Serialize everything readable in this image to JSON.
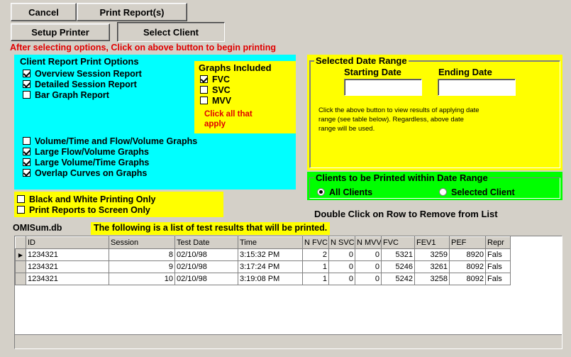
{
  "toolbar": {
    "cancel": "Cancel",
    "print_reports": "Print Report(s)",
    "setup_printer": "Setup Printer",
    "select_client": "Select Client"
  },
  "instruction": "After selecting options, Click on above button to begin printing",
  "client_report_options": {
    "title": "Client Report Print Options",
    "items": [
      {
        "label": "Overview Session Report",
        "checked": true
      },
      {
        "label": "Detailed Session Report",
        "checked": true
      },
      {
        "label": "Bar Graph Report",
        "checked": false
      }
    ],
    "graph_items": [
      {
        "label": "Volume/Time and Flow/Volume Graphs",
        "checked": false
      },
      {
        "label": "Large Flow/Volume Graphs",
        "checked": true
      },
      {
        "label": "Large Volume/Time Graphs",
        "checked": true
      },
      {
        "label": "Overlap Curves on Graphs",
        "checked": true
      }
    ]
  },
  "graphs_included": {
    "title": "Graphs Included",
    "items": [
      {
        "label": "FVC",
        "checked": true
      },
      {
        "label": "SVC",
        "checked": false
      },
      {
        "label": "MVV",
        "checked": false
      }
    ],
    "note_line1": "Click all that",
    "note_line2": "apply"
  },
  "print_flags": [
    {
      "label": "Black and White Printing Only",
      "checked": false
    },
    {
      "label": "Print Reports to Screen Only",
      "checked": false
    }
  ],
  "date_range": {
    "title": "Selected Date Range",
    "start_label": "Starting Date",
    "end_label": "Ending Date",
    "start_value": "",
    "end_value": "",
    "help_line1": "Click the above button to view results of applying date",
    "help_line2": "range (see table below). Regardless, above date",
    "help_line3": "range will be used."
  },
  "clients_group": {
    "title": "Clients to be Printed within Date Range",
    "all_clients": "All Clients",
    "selected_client": "Selected Client",
    "selected": "all"
  },
  "double_click_hint": "Double Click on Row to Remove from List",
  "db_name": "OMISum.db",
  "list_caption": "The following is a list of test results that will be printed.",
  "table": {
    "columns": [
      "ID",
      "Session",
      "Test Date",
      "Time",
      "N FVC",
      "N SVC",
      "N MVV",
      "FVC",
      "FEV1",
      "PEF",
      "Repr"
    ],
    "rows": [
      [
        "1234321",
        "8",
        "02/10/98",
        "3:15:32 PM",
        "2",
        "0",
        "0",
        "5321",
        "3259",
        "8920",
        "Fals"
      ],
      [
        "1234321",
        "9",
        "02/10/98",
        "3:17:24 PM",
        "1",
        "0",
        "0",
        "5246",
        "3261",
        "8092",
        "Fals"
      ],
      [
        "1234321",
        "10",
        "02/10/98",
        "3:19:08 PM",
        "1",
        "0",
        "0",
        "5242",
        "3258",
        "8092",
        "Fals"
      ]
    ]
  },
  "colors": {
    "cyan": "#00ffff",
    "yellow": "#ffff00",
    "green": "#00ff00",
    "red": "#e00000"
  }
}
